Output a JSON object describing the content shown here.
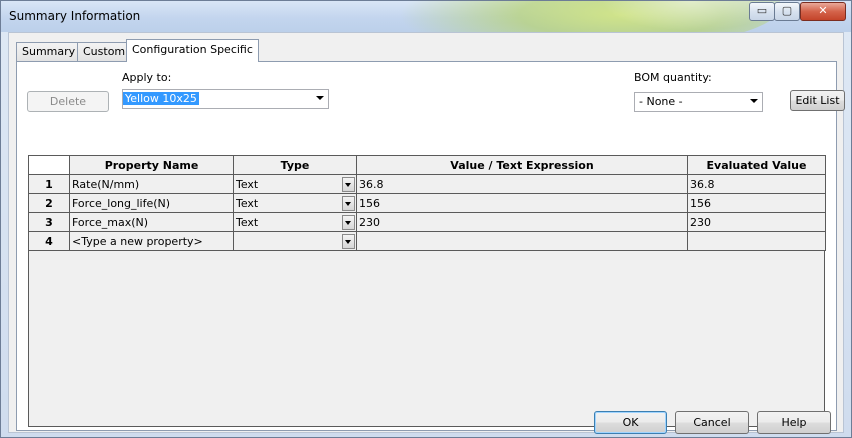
{
  "window": {
    "title": "Summary Information"
  },
  "window_controls": {
    "minimize": "▭",
    "maximize": "▢",
    "close": "✕"
  },
  "tabs": [
    {
      "label": "Summary"
    },
    {
      "label": "Custom"
    },
    {
      "label": "Configuration Specific"
    }
  ],
  "toolbar": {
    "delete_label": "Delete",
    "apply_to_label": "Apply to:",
    "apply_to_value": "Yellow 10x25",
    "bom_quantity_label": "BOM quantity:",
    "bom_quantity_value": "- None -",
    "edit_list_label": "Edit List"
  },
  "table": {
    "headers": [
      "Property Name",
      "Type",
      "Value / Text Expression",
      "Evaluated Value"
    ],
    "rows": [
      {
        "num": "1",
        "name": "Rate(N/mm)",
        "type": "Text",
        "value": "36.8",
        "evaluated": "36.8"
      },
      {
        "num": "2",
        "name": "Force_long_life(N)",
        "type": "Text",
        "value": "156",
        "evaluated": "156"
      },
      {
        "num": "3",
        "name": "Force_max(N)",
        "type": "Text",
        "value": "230",
        "evaluated": "230"
      },
      {
        "num": "4",
        "name": "<Type a new property>",
        "type": "",
        "value": "",
        "evaluated": ""
      }
    ]
  },
  "footer": {
    "ok_label": "OK",
    "cancel_label": "Cancel",
    "help_label": "Help"
  }
}
